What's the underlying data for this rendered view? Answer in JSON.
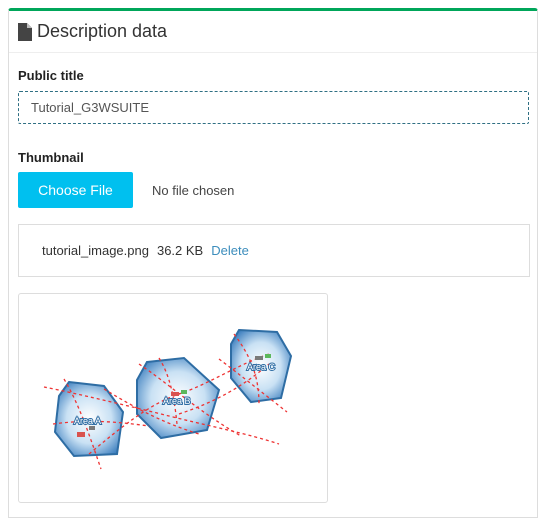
{
  "panel": {
    "title": "Description data",
    "header_icon": "file-icon",
    "accent_color": "#00a65a"
  },
  "form": {
    "public_title_label": "Public title",
    "public_title_value": "Tutorial_G3WSUITE",
    "thumbnail_label": "Thumbnail",
    "choose_file_label": "Choose File",
    "no_file_text": "No file chosen"
  },
  "uploaded_file": {
    "name": "tutorial_image.png",
    "size": "36.2 KB",
    "delete_label": "Delete"
  },
  "thumbnail_image": {
    "areas": [
      "Area A",
      "Area B",
      "Area C"
    ]
  }
}
